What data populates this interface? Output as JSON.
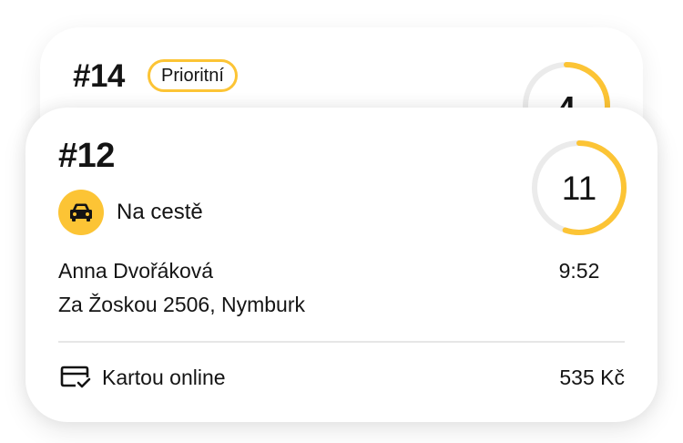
{
  "back_order": {
    "number": "#14",
    "badge": "Prioritní",
    "timer": "4",
    "timer_progress": 0.3
  },
  "front_order": {
    "number": "#12",
    "status_icon": "car-icon",
    "status": "Na cestě",
    "timer": "11",
    "timer_progress": 0.55,
    "time": "9:52",
    "customer_name": "Anna Dvořáková",
    "address": "Za Žoskou 2506, Nymburk",
    "payment_icon": "credit-card-check-icon",
    "payment": "Kartou online",
    "price": "535 Kč"
  },
  "colors": {
    "accent": "#FCC435",
    "ring_track": "#EBEBEB",
    "text": "#141414"
  }
}
